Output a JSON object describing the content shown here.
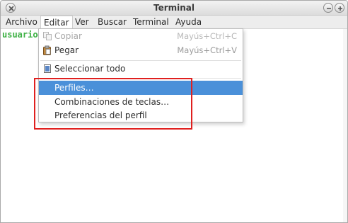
{
  "window": {
    "title": "Terminal"
  },
  "menubar": {
    "items": [
      {
        "label": "Archivo"
      },
      {
        "label": "Editar"
      },
      {
        "label": "Ver"
      },
      {
        "label": "Buscar"
      },
      {
        "label": "Terminal"
      },
      {
        "label": "Ayuda"
      }
    ]
  },
  "terminal": {
    "prompt": "usuario@"
  },
  "edit_menu": {
    "items": [
      {
        "label": "Copiar",
        "accel": "Mayús+Ctrl+C",
        "icon": "copy-icon",
        "enabled": false
      },
      {
        "label": "Pegar",
        "accel": "Mayús+Ctrl+V",
        "icon": "paste-icon",
        "enabled": true
      },
      {
        "label": "Seleccionar todo",
        "icon": "select-all-icon",
        "enabled": true
      },
      {
        "label": "Perfiles…",
        "enabled": true,
        "highlighted": true
      },
      {
        "label": "Combinaciones de teclas…",
        "enabled": true
      },
      {
        "label": "Preferencias del perfil",
        "enabled": true
      }
    ]
  },
  "colors": {
    "highlight": "#4a90d9",
    "prompt": "#3cb043",
    "annotation": "#e0201f"
  }
}
